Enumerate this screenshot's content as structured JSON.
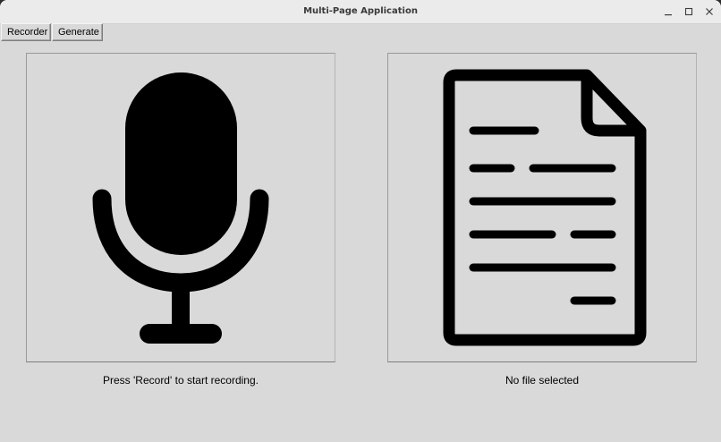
{
  "window": {
    "title": "Multi-Page Application",
    "controls": {
      "minimize_icon": "minimize-icon",
      "maximize_icon": "maximize-icon",
      "close_icon": "close-icon"
    }
  },
  "toolbar": {
    "recorder_label": "Recorder",
    "generate_label": "Generate"
  },
  "recorder_panel": {
    "icon": "microphone-icon",
    "status": "Press 'Record' to start recording."
  },
  "file_panel": {
    "icon": "document-icon",
    "status": "No file selected"
  },
  "colors": {
    "window_bg": "#d9d9d9",
    "titlebar_bg": "#ebebeb",
    "icon_color": "#000000"
  }
}
